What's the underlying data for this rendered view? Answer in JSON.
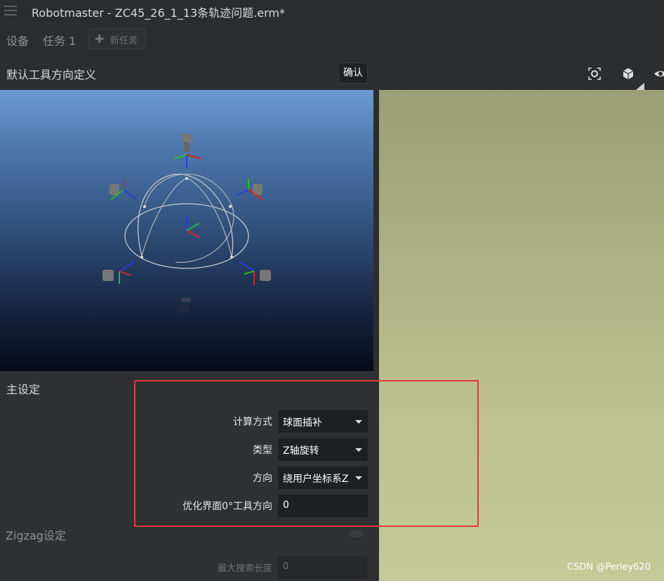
{
  "window": {
    "title": "Robotmaster - ZC45_26_1_13条轨迹问题.erm*"
  },
  "tabs": [
    {
      "label": "设备"
    },
    {
      "label": "任务 1"
    }
  ],
  "new_task_button": {
    "label": "新任务"
  },
  "panel": {
    "title": "默认工具方向定义",
    "confirm_label": "确认"
  },
  "toolbar_icons": [
    "target-icon",
    "cube-icon",
    "eye-icon"
  ],
  "main_settings": {
    "title": "主设定",
    "rows": [
      {
        "label": "计算方式",
        "value": "球面插补",
        "kind": "dropdown"
      },
      {
        "label": "类型",
        "value": "Z轴旋转",
        "kind": "dropdown"
      },
      {
        "label": "方向",
        "value": "绕用户坐标系Z",
        "kind": "dropdown"
      },
      {
        "label": "优化界面0°工具方向",
        "value": "0",
        "kind": "input"
      }
    ]
  },
  "zigzag": {
    "title": "Zigzag设定",
    "max_search_label": "最大搜索长度",
    "max_search_value": "0"
  },
  "watermark": "CSDN @Perley620",
  "colors": {
    "highlight": "#e03a3a",
    "viewport": "#bcc18e",
    "axis_x": "#e02020",
    "axis_y": "#20c020",
    "axis_z": "#2040e0"
  }
}
